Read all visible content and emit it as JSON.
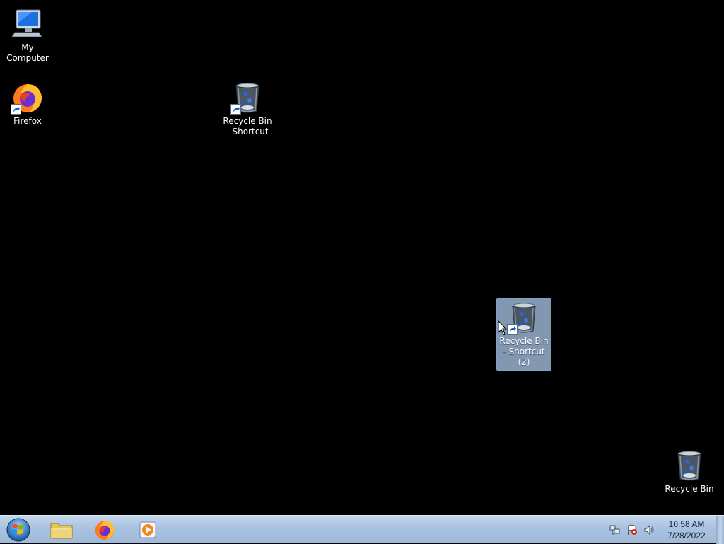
{
  "desktop": {
    "icons": [
      {
        "label": "My Computer",
        "icon": "computer-icon",
        "shortcut": false,
        "selected": false
      },
      {
        "label": "Firefox",
        "icon": "firefox-icon",
        "shortcut": true,
        "selected": false
      },
      {
        "label": "Recycle Bin - Shortcut",
        "icon": "recycle-bin-icon",
        "shortcut": true,
        "selected": false
      },
      {
        "label": "Recycle Bin - Shortcut (2)",
        "icon": "recycle-bin-icon",
        "shortcut": true,
        "selected": true
      },
      {
        "label": "Recycle Bin",
        "icon": "recycle-bin-icon",
        "shortcut": false,
        "selected": false
      }
    ]
  },
  "taskbar": {
    "start_icon": "windows-start-orb",
    "pinned": [
      {
        "name": "Windows Explorer",
        "icon": "folder-icon"
      },
      {
        "name": "Firefox",
        "icon": "firefox-icon"
      },
      {
        "name": "Windows Media Player",
        "icon": "media-player-icon"
      }
    ],
    "tray": {
      "icons": [
        "network-icon",
        "action-center-flag-icon",
        "volume-icon"
      ],
      "time": "10:58 AM",
      "date": "7/28/2022"
    }
  },
  "colors": {
    "desktop_background": "#000000",
    "selection_fill": "#adc9eb",
    "taskbar": "#a9c2df"
  }
}
